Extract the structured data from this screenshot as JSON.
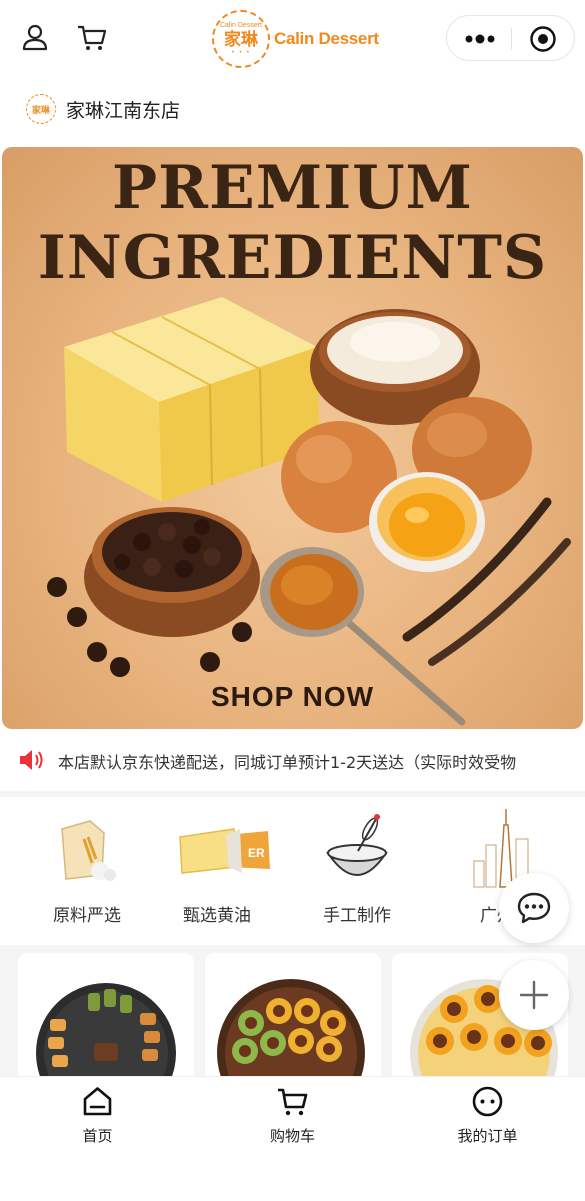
{
  "header": {
    "left_icons": [
      "user-icon",
      "cart-icon"
    ],
    "logo": {
      "badge_en": "Calin Dessert",
      "badge_cn": "家琳",
      "text": "Calin Dessert"
    },
    "capsule_icons": [
      "more-icon",
      "close-icon"
    ]
  },
  "store": {
    "badge": "家琳",
    "name": "家琳江南东店"
  },
  "banner": {
    "title_line1": "PREMIUM",
    "title_line2": "INGREDIENTS",
    "cta": "SHOP NOW"
  },
  "notice": {
    "icon": "speaker-icon",
    "text": "本店默认京东快递配送，同城订单预计1-2天送达（实际时效受物"
  },
  "categories": [
    {
      "label": "原料严选",
      "icon": "flour-bag-icon"
    },
    {
      "label": "甄选黄油",
      "icon": "butter-icon"
    },
    {
      "label": "手工制作",
      "icon": "whisk-bowl-icon"
    },
    {
      "label": "广州",
      "icon": "city-skyline-icon"
    }
  ],
  "products": [
    {
      "icon": "cookie-tray-icon"
    },
    {
      "icon": "egg-roll-tray-icon"
    },
    {
      "icon": "egg-roll-tin-icon"
    }
  ],
  "floating": [
    "chat-icon",
    "plus-icon"
  ],
  "tabs": [
    {
      "label": "首页",
      "icon": "home-icon"
    },
    {
      "label": "购物车",
      "icon": "cart-icon"
    },
    {
      "label": "我的订单",
      "icon": "order-icon"
    }
  ],
  "colors": {
    "brand": "#f08a1e",
    "alert": "#e8333a",
    "banner_bg": "#e8b37e"
  }
}
